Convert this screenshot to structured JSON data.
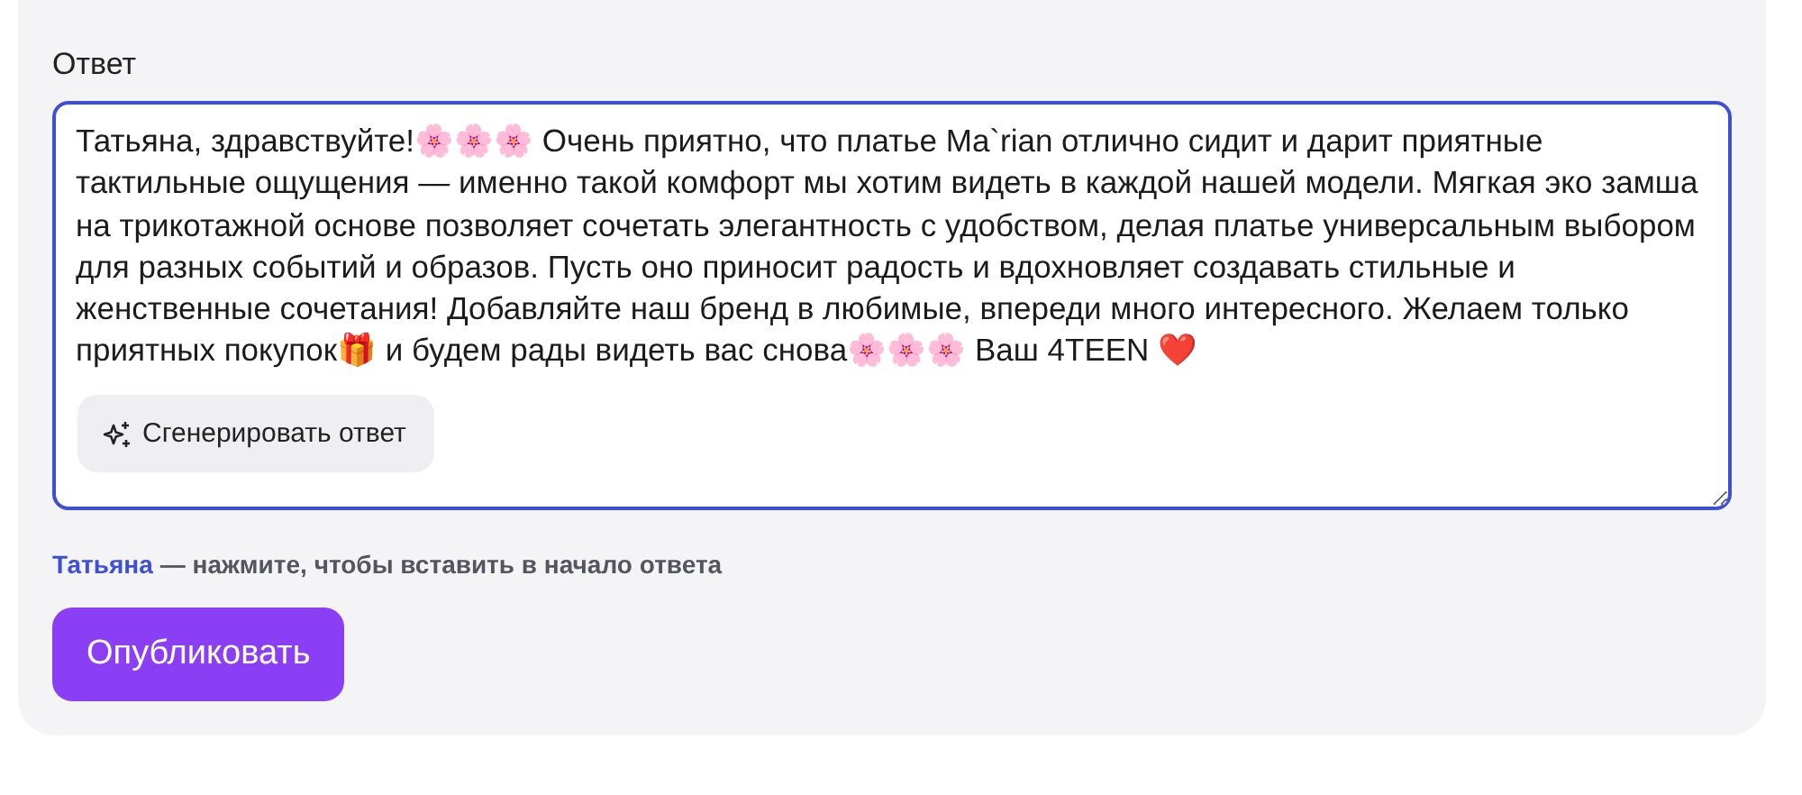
{
  "answer": {
    "label": "Ответ",
    "value": "Татьяна, здравствуйте!🌸🌸🌸 Очень приятно, что платье Ma`rian отлично сидит и дарит приятные тактильные ощущения — именно такой комфорт мы хотим видеть в каждой нашей модели. Мягкая эко замша на трикотажной основе позволяет сочетать элегантность с удобством, делая платье универсальным выбором для разных событий и образов. Пусть оно приносит радость и вдохновляет создавать стильные и женственные сочетания! Добавляйте наш бренд в любимые, впереди много интересного. Желаем только приятных покупок🎁 и будем рады видеть вас снова🌸🌸🌸 Ваш 4TEEN ❤️",
    "generate_button": "Сгенерировать ответ"
  },
  "hint": {
    "name": "Татьяна",
    "text": "— нажмите, чтобы вставить в начало ответа"
  },
  "publish_button": "Опубликовать"
}
